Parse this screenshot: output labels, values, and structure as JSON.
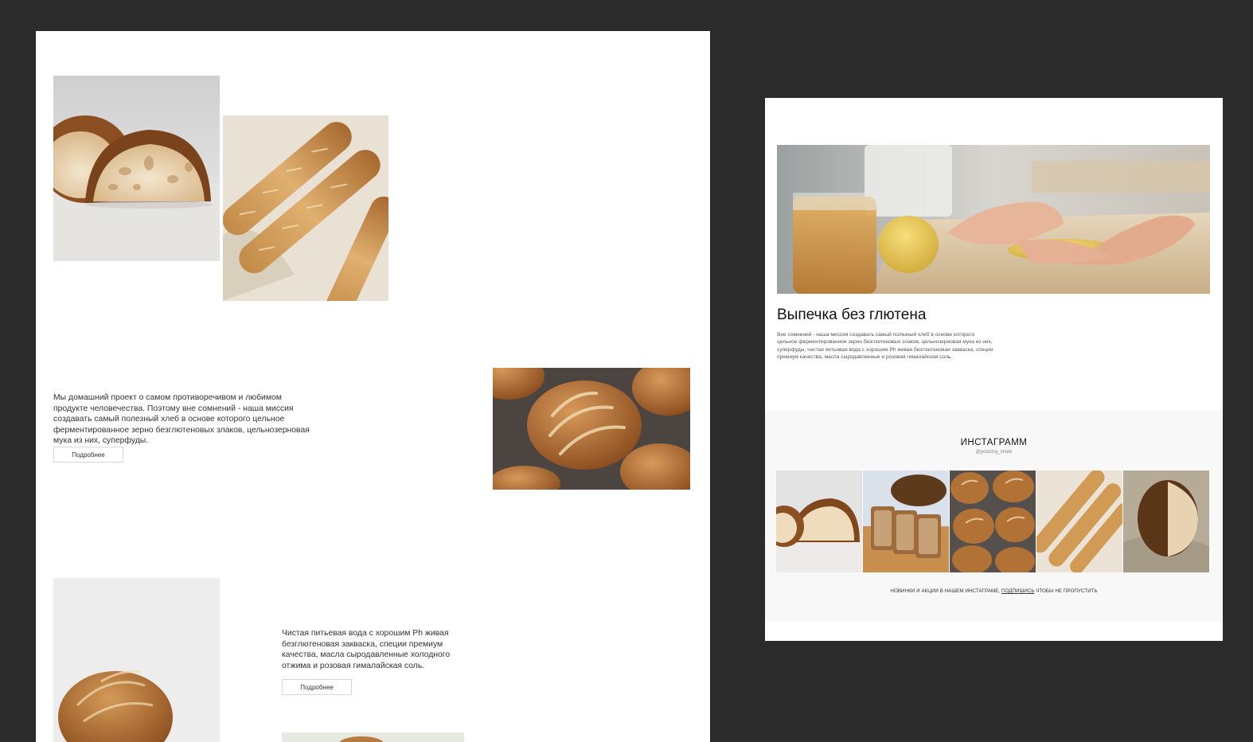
{
  "left_page": {
    "intro_text": "Мы домашний проект о самом противоречивом и любимом продукте человечества. Поэтому вне сомнений - наша миссия создавать самый полезный хлеб в основе которого цельное ферментированное зерно безглютеновых злаков, цельнозерновая мука из них, суперфуды.",
    "intro_button": "Подробнее",
    "water_text": "Чистая питьевая вода с хорошим Ph живая безглютеновая закваска, специи премиум качества, масла сыродавленные холодного отжима и розовая гималайская соль.",
    "water_button": "Подробнее"
  },
  "right_page": {
    "title": "Выпечка без глютена",
    "description": "Вне сомнений - наша миссия создавать самый полезный хлеб в основе которого цельное ферментированное зерно безглютеновых злаков, цельнозерновая мука из них, суперфуды, чистая питьевая вода с хорошим Ph живая безглютеновая закваска, специи премиум качества, масла сыродавленные и розовая гималайская соль.",
    "instagram": {
      "title": "ИНСТАГРАММ",
      "handle": "@polezniy_khleb",
      "footer_before": "НОВИНКИ И АКЦИИ В НАШЕМ ИНСТАГРАМЕ,",
      "footer_link": "ПОДПИШИСЬ",
      "footer_after": "ЧТОБЫ НЕ ПРОПУСТИТЬ"
    }
  },
  "colors": {
    "background": "#2b2b2b",
    "page": "#ffffff",
    "instagram_bg": "#f8f8f8",
    "crust": "#a86a33",
    "crumb": "#efdcbc"
  },
  "icons": {
    "photos": [
      "sourdough-loaf-cut-photo",
      "baguettes-photo",
      "round-loaves-photo",
      "round-loaf-photo",
      "bread-bottom-photo",
      "dough-kneading-photo"
    ],
    "instagram_grid": [
      "loaf-cut-photo",
      "sliced-bread-photo",
      "round-loaves-photo",
      "baguettes-photo",
      "loaf-on-cloth-photo"
    ]
  }
}
